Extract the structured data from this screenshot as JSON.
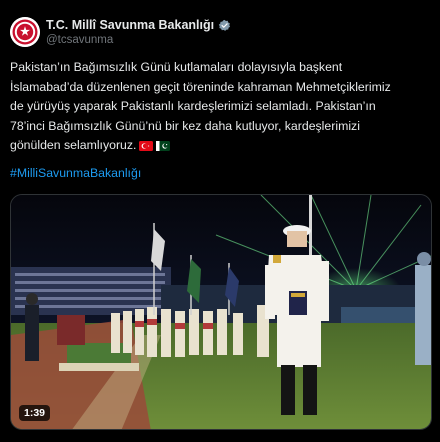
{
  "account": {
    "display_name": "T.C. Millî Savunma Bakanlığı",
    "handle": "@tcsavunma",
    "verified_icon": "verified-badge-icon",
    "avatar_icon": "crest-logo"
  },
  "tweet": {
    "lines": [
      "Pakistan’ın Bağımsızlık Günü kutlamaları dolayısıyla başkent",
      "İslamabad’da düzenlenen geçit töreninde kahraman Mehmetçiklerimiz",
      "de yürüyüş yaparak Pakistanlı kardeşlerimizi selamladı. Pakistan’ın",
      "78’inci Bağımsızlık Günü’nü bir kez daha kutluyor, kardeşlerimizi",
      "gönülden selamlıyoruz."
    ],
    "flags": [
      "turkey-flag",
      "pakistan-flag"
    ],
    "hashtag": "#MilliSavunmaBakanlığı"
  },
  "media": {
    "type": "video",
    "duration": "1:39"
  },
  "colors": {
    "background": "#000000",
    "text": "#e7e9ea",
    "muted": "#71767b",
    "link": "#1d9bf0"
  }
}
